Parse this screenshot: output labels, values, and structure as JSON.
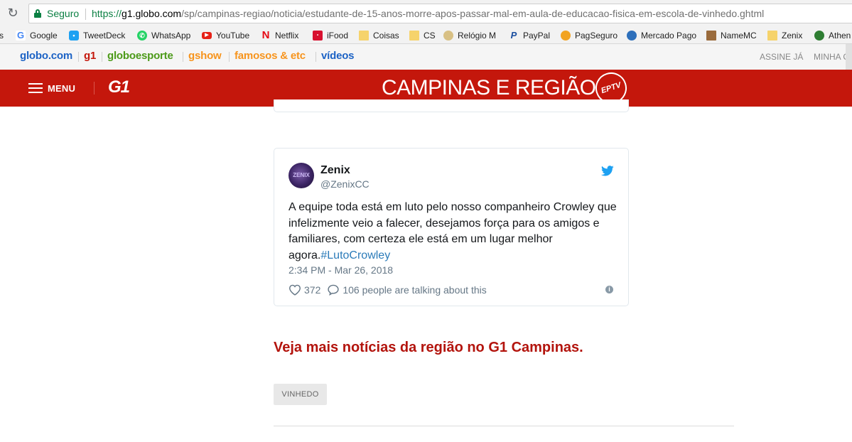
{
  "browser": {
    "secure_label": "Seguro",
    "url_scheme": "https://",
    "url_host": "g1.globo.com",
    "url_path": "/sp/campinas-regiao/noticia/estudante-de-15-anos-morre-apos-passar-mal-em-aula-de-educacao-fisica-em-escola-de-vinhedo.ghtml"
  },
  "bookmarks": {
    "cut_label": "s",
    "items": [
      {
        "label": "Google",
        "icon": "google-icon"
      },
      {
        "label": "TweetDeck",
        "icon": "tweetdeck-icon"
      },
      {
        "label": "WhatsApp",
        "icon": "whatsapp-icon"
      },
      {
        "label": "YouTube",
        "icon": "youtube-icon"
      },
      {
        "label": "Netflix",
        "icon": "netflix-icon"
      },
      {
        "label": "iFood",
        "icon": "ifood-icon"
      },
      {
        "label": "Coisas",
        "icon": "folder-icon"
      },
      {
        "label": "CS",
        "icon": "folder-icon"
      },
      {
        "label": "Relógio M",
        "icon": "clock-icon"
      },
      {
        "label": "PayPal",
        "icon": "paypal-icon"
      },
      {
        "label": "PagSeguro",
        "icon": "pagseguro-icon"
      },
      {
        "label": "Mercado Pago",
        "icon": "mercadopago-icon"
      },
      {
        "label": "NameMC",
        "icon": "namemc-icon"
      },
      {
        "label": "Zenix",
        "icon": "folder-icon"
      },
      {
        "label": "Athen",
        "icon": "athena-icon"
      }
    ]
  },
  "globobar": {
    "links": [
      {
        "label": "globo.com",
        "color": "#1d63c5"
      },
      {
        "label": "g1",
        "color": "#c4170c"
      },
      {
        "label": "globoesporte",
        "color": "#4c9a19"
      },
      {
        "label": "gshow",
        "color": "#f7941d"
      },
      {
        "label": "famosos & etc",
        "color": "#f7941d"
      },
      {
        "label": "vídeos",
        "color": "#1d63c5"
      }
    ],
    "subscribe": "ASSINE JÁ",
    "account": "MINHA C"
  },
  "header": {
    "menu_label": "MENU",
    "g1_logo": "G1",
    "region_title": "CAMPINAS E REGIÃO",
    "affiliate_logo": "EPTV",
    "brand_color": "#c4170c"
  },
  "tweet": {
    "avatar_text": "ZENIX",
    "name": "Zenix",
    "handle": "@ZenixCC",
    "text": "A equipe toda está em luto pelo nosso companheiro Crowley que infelizmente veio a falecer, desejamos força para os amigos e familiares, com certeza ele está em um lugar melhor agora.",
    "hashtag": "#LutoCrowley",
    "timestamp": "2:34 PM - Mar 26, 2018",
    "likes": "372",
    "talking": "106 people are talking about this",
    "info": "i"
  },
  "more_news": "Veja mais notícias da região no G1 Campinas.",
  "tag": "VINHEDO"
}
